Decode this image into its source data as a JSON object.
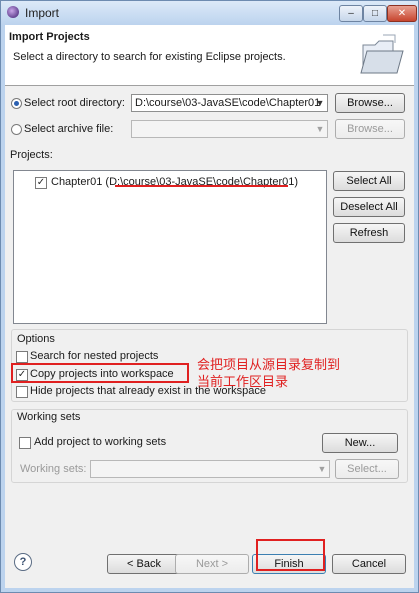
{
  "window": {
    "title": "Import",
    "controls": {
      "minimize": "–",
      "maximize": "□",
      "close": "✕"
    }
  },
  "header": {
    "title": "Import Projects",
    "description": "Select a directory to search for existing Eclipse projects."
  },
  "source": {
    "root_directory_label": "Select root directory:",
    "root_directory_value": "D:\\course\\03-JavaSE\\code\\Chapter01",
    "root_directory_selected": true,
    "archive_file_label": "Select archive file:",
    "archive_file_value": "",
    "browse_label": "Browse...",
    "browse_archive_label": "Browse..."
  },
  "projects": {
    "label": "Projects:",
    "items": [
      {
        "name": "Chapter01 (D:\\course\\03-JavaSE\\code\\Chapter01)",
        "checked": true
      }
    ],
    "select_all_label": "Select All",
    "deselect_all_label": "Deselect All",
    "refresh_label": "Refresh"
  },
  "options": {
    "group_label": "Options",
    "search_nested_label": "Search for nested projects",
    "search_nested_checked": false,
    "copy_projects_label": "Copy projects into workspace",
    "copy_projects_checked": true,
    "hide_existing_label": "Hide projects that already exist in the workspace",
    "hide_existing_checked": false
  },
  "annotation": {
    "line1": "会把项目从源目录复制到",
    "line2": "当前工作区目录"
  },
  "working_sets": {
    "group_label": "Working sets",
    "add_label": "Add project to working sets",
    "add_checked": false,
    "new_label": "New...",
    "sets_label": "Working sets:",
    "sets_value": "",
    "select_label": "Select..."
  },
  "footer": {
    "help_icon": "?",
    "back_label": "< Back",
    "next_label": "Next >",
    "finish_label": "Finish",
    "cancel_label": "Cancel"
  },
  "colors": {
    "highlight": "#e02020",
    "title_bar": "#bcd3ee"
  }
}
